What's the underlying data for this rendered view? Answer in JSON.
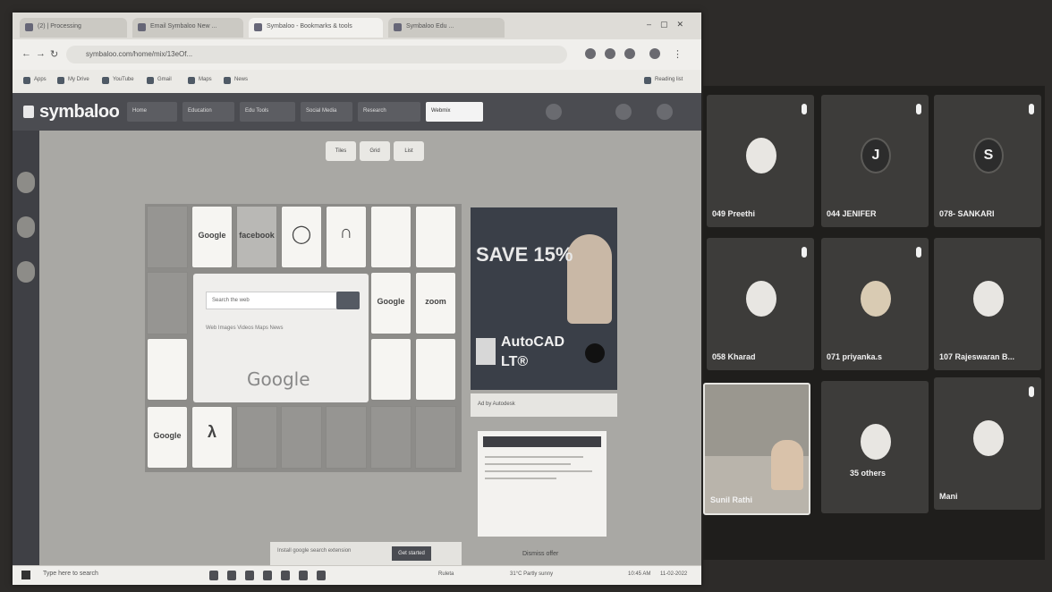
{
  "browser": {
    "tabs": [
      {
        "label": "(2) | Processing",
        "active": false
      },
      {
        "label": "Email Symbaloo New ...",
        "active": false
      },
      {
        "label": "Symbaloo - Bookmarks & tools",
        "active": true
      },
      {
        "label": "Symbaloo Edu ...",
        "active": false
      }
    ],
    "url": "symbaloo.com/home/mix/13eOf...",
    "bookmarks": [
      "Apps",
      "My Drive",
      "YouTube",
      "Gmail",
      "Maps",
      "News"
    ],
    "reading_list": "Reading list"
  },
  "symbaloo": {
    "logo": "symbaloo",
    "webmix_tabs": [
      "Home",
      "Education",
      "Edu Tools",
      "Social Media",
      "Research",
      "Webmix"
    ],
    "view_buttons": [
      "Tiles",
      "Grid",
      "List"
    ],
    "tiles": {
      "google": "Google",
      "facebook": "facebook",
      "google2": "Google",
      "zoom": "zoom",
      "google3": "Google"
    },
    "search_tile": {
      "placeholder": "Search the web",
      "options": "Web   Images   Videos   Maps   News",
      "engine": "Google"
    },
    "ad": {
      "headline": "SAVE 15%",
      "product_line1": "AutoCAD",
      "product_line2": "LT®",
      "bar": "Ad by Autodesk"
    },
    "footer": {
      "input": "Install google search extension",
      "button": "Get started",
      "dismiss": "Dismiss offer"
    }
  },
  "taskbar": {
    "search": "Type here to search",
    "status": "Ruleta",
    "weather": "31°C Partly sunny",
    "time": "10:45 AM",
    "date": "11-02-2022"
  },
  "gallery": {
    "participants": [
      {
        "name": "049 Preethi",
        "initial": ""
      },
      {
        "name": "044 JENIFER",
        "initial": "J"
      },
      {
        "name": "078- SANKARI",
        "initial": "S"
      },
      {
        "name": "058 Kharad",
        "initial": ""
      },
      {
        "name": "071 priyanka.s",
        "initial": ""
      },
      {
        "name": "107 Rajeswaran B...",
        "initial": ""
      },
      {
        "name": "Sunil Rathi",
        "initial": ""
      },
      {
        "name": "35 others",
        "initial": ""
      },
      {
        "name": "Mani",
        "initial": ""
      }
    ]
  },
  "colors": {
    "app_header": "#4b4c51",
    "workspace": "#a9a8a4",
    "gallery_bg": "#1f1e1c",
    "tile_bg": "#3d3c3a"
  }
}
